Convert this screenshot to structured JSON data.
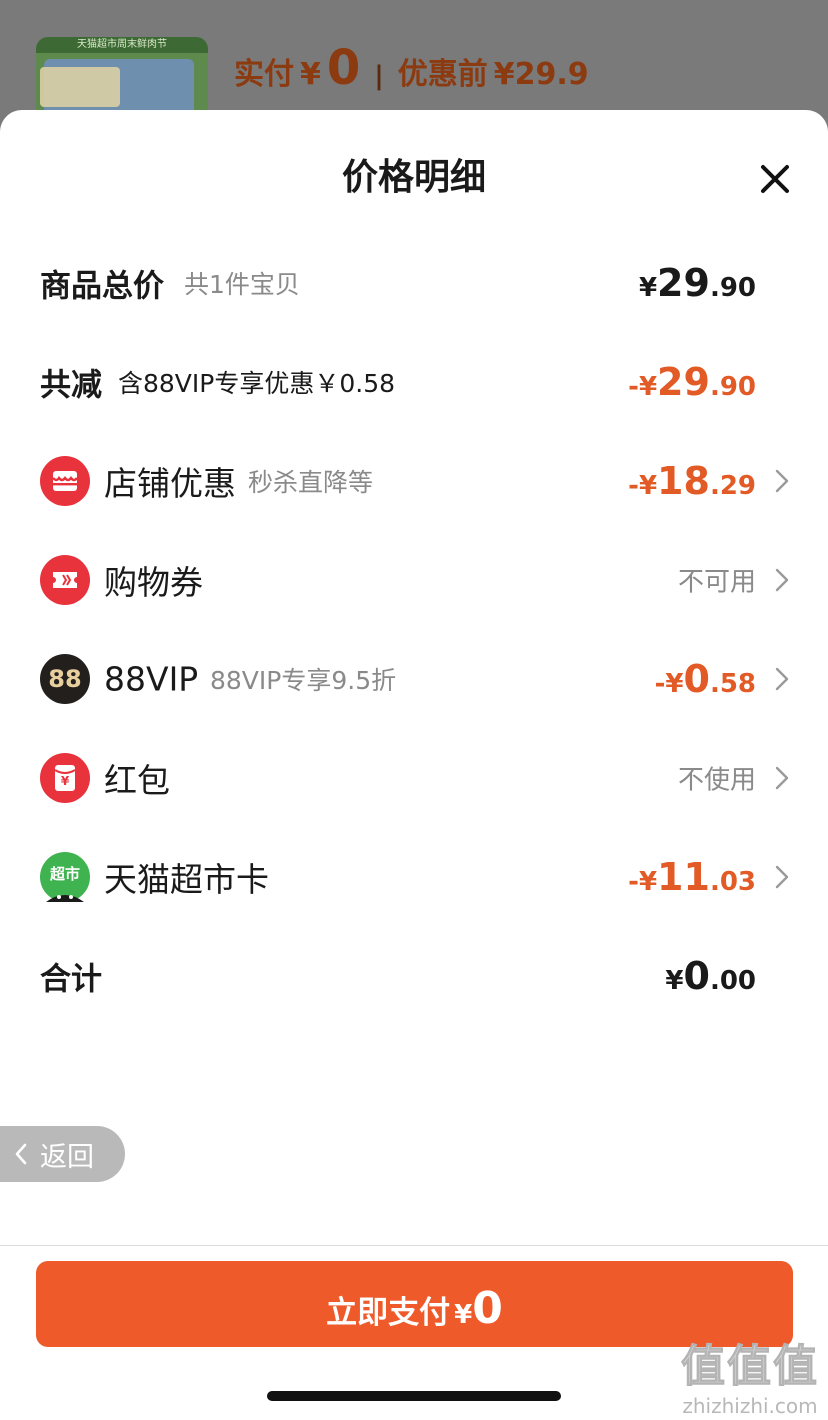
{
  "background": {
    "thumb_banner": "天猫超市周末鲜肉节",
    "paid_label": "实付",
    "paid_yen": "¥",
    "paid_value": "0",
    "before_label": "优惠前",
    "before_value": "¥29.9"
  },
  "sheet": {
    "title": "价格明细"
  },
  "rows": {
    "total": {
      "label": "商品总价",
      "sub": "共1件宝贝",
      "yen": "¥",
      "int": "29",
      "dec": ".90"
    },
    "reduced": {
      "label": "共减",
      "sub": "含88VIP专享优惠￥0.58",
      "yen": "-¥",
      "int": "29",
      "dec": ".90"
    },
    "shop_discount": {
      "icon": "shop-icon",
      "label": "店铺优惠",
      "sub": "秒杀直降等",
      "yen": "-¥",
      "int": "18",
      "dec": ".29"
    },
    "coupon": {
      "icon": "ticket-icon",
      "label": "购物券",
      "status": "不可用"
    },
    "vip": {
      "icon": "88-icon",
      "icon_text": "88",
      "label": "88VIP",
      "sub": "88VIP专享9.5折",
      "yen": "-¥",
      "int": "0",
      "dec": ".58"
    },
    "red_packet": {
      "icon": "red-packet-icon",
      "icon_text": "¥",
      "label": "红包",
      "status": "不使用"
    },
    "market_card": {
      "icon": "tmall-market-icon",
      "icon_text": "超市",
      "label": "天猫超市卡",
      "yen": "-¥",
      "int": "11",
      "dec": ".03"
    },
    "sum": {
      "label": "合计",
      "yen": "¥",
      "int": "0",
      "dec": ".00"
    }
  },
  "back": {
    "label": "返回"
  },
  "pay": {
    "label": "立即支付",
    "yen": "¥",
    "value": "0"
  },
  "watermark": {
    "logo": "值值值",
    "domain": "zhizhizhi.com"
  },
  "colors": {
    "accent": "#ee5a2a",
    "discount": "#e25a25",
    "icon_red": "#e8323c",
    "icon_green": "#3fb34f"
  }
}
